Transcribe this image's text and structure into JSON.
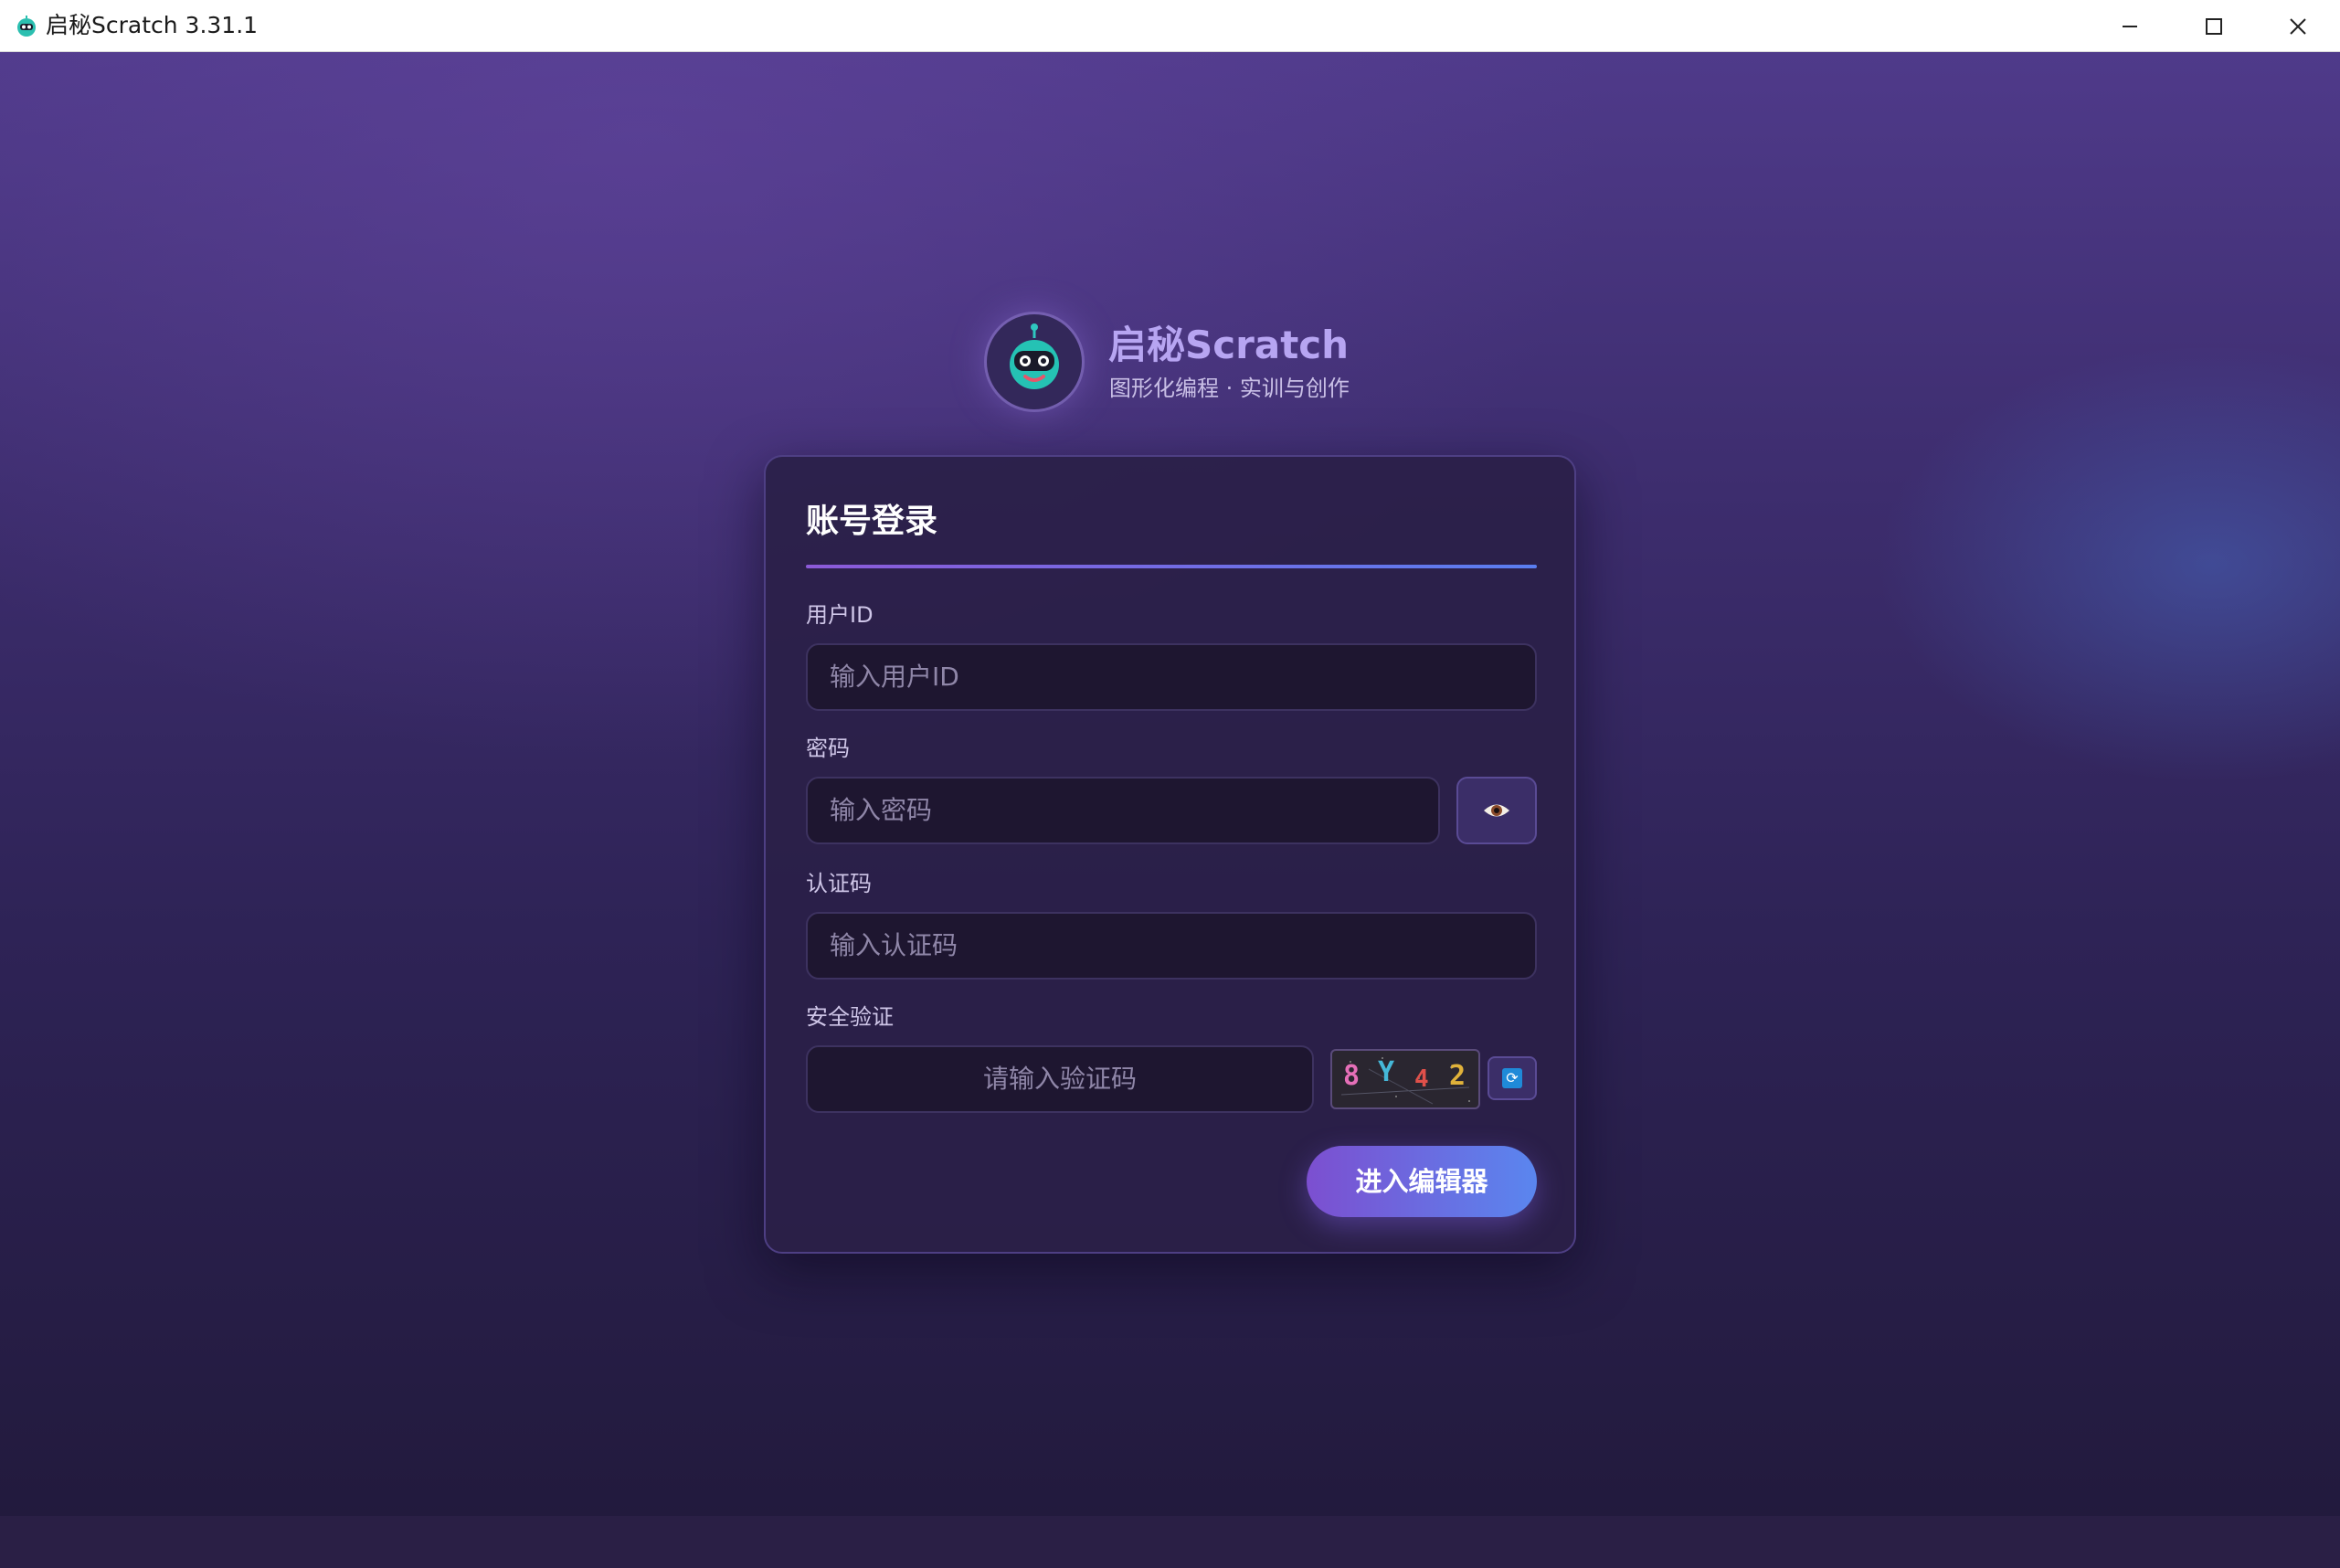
{
  "window": {
    "title": "启秘Scratch 3.31.1",
    "icon": "robot-icon"
  },
  "brand": {
    "title": "启秘Scratch",
    "subtitle": "图形化编程 · 实训与创作"
  },
  "login": {
    "title": "账号登录",
    "user_id": {
      "label": "用户ID",
      "placeholder": "输入用户ID",
      "value": ""
    },
    "password": {
      "label": "密码",
      "placeholder": "输入密码",
      "value": "",
      "toggle_icon": "eye-icon"
    },
    "auth_code": {
      "label": "认证码",
      "placeholder": "输入认证码",
      "value": ""
    },
    "security": {
      "label": "安全验证",
      "placeholder": "请输入验证码",
      "captcha_chars": [
        "8",
        "Y",
        "4",
        "2"
      ],
      "captcha_colors": [
        "#e56fb8",
        "#45b7d8",
        "#e0504a",
        "#e0b23a"
      ],
      "refresh_icon": "refresh-icon"
    },
    "submit_label": "进入编辑器"
  },
  "colors": {
    "accent_start": "#7c4fd0",
    "accent_end": "#5a86ef",
    "brand_text": "#b7a5f2"
  }
}
